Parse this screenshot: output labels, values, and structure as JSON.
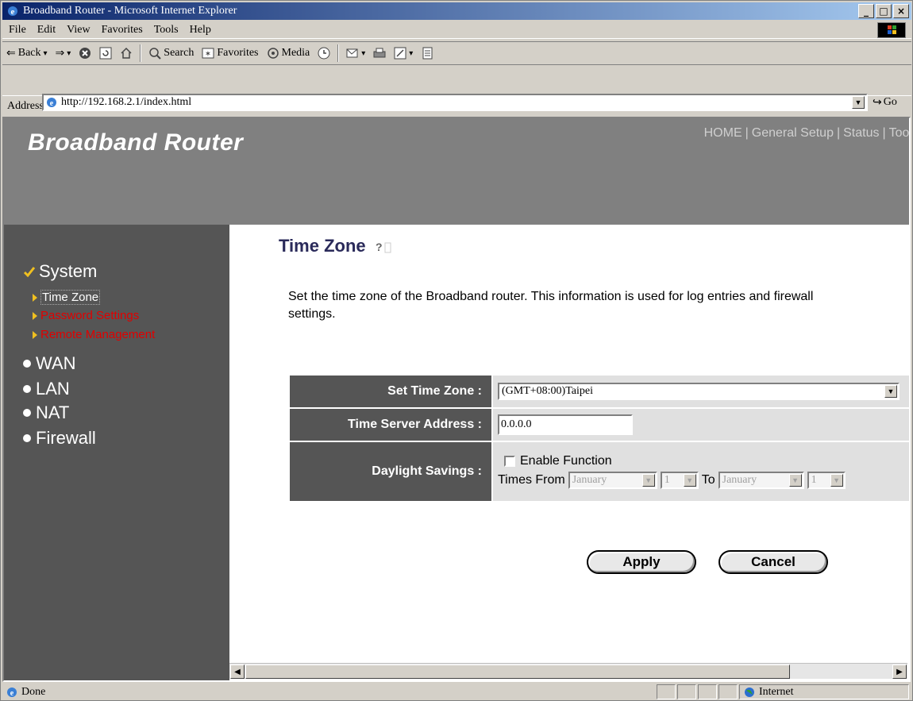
{
  "window": {
    "title": "Broadband Router - Microsoft Internet Explorer"
  },
  "menu": [
    "File",
    "Edit",
    "View",
    "Favorites",
    "Tools",
    "Help"
  ],
  "toolbar": {
    "back": "Back",
    "search": "Search",
    "favorites": "Favorites",
    "media": "Media"
  },
  "address": {
    "label": "Address",
    "url": "http://192.168.2.1/index.html",
    "go": "Go"
  },
  "header": {
    "brand": "Broadband Router",
    "nav": [
      "HOME",
      "General Setup",
      "Status",
      "Tool"
    ]
  },
  "sidebar": {
    "system": "System",
    "sub_items": [
      {
        "label": "Time Zone",
        "active": true
      },
      {
        "label": "Password Settings",
        "active": false
      },
      {
        "label": "Remote Management",
        "active": false
      }
    ],
    "items": [
      "WAN",
      "LAN",
      "NAT",
      "Firewall"
    ]
  },
  "content": {
    "title": "Time Zone",
    "description": "Set the time zone of the Broadband router. This information is used for log entries and firewall settings.",
    "form": {
      "time_zone_label": "Set Time Zone :",
      "time_zone_value": "(GMT+08:00)Taipei",
      "server_label": "Time Server Address :",
      "server_value": "0.0.0.0",
      "daylight_label": "Daylight Savings :",
      "enable_label": "Enable Function",
      "times_from": "Times From",
      "from_month": "January",
      "from_day": "1",
      "to_label": "To",
      "to_month": "January",
      "to_day": "1"
    },
    "apply": "Apply",
    "cancel": "Cancel"
  },
  "status": {
    "left": "Done",
    "zone": "Internet"
  }
}
